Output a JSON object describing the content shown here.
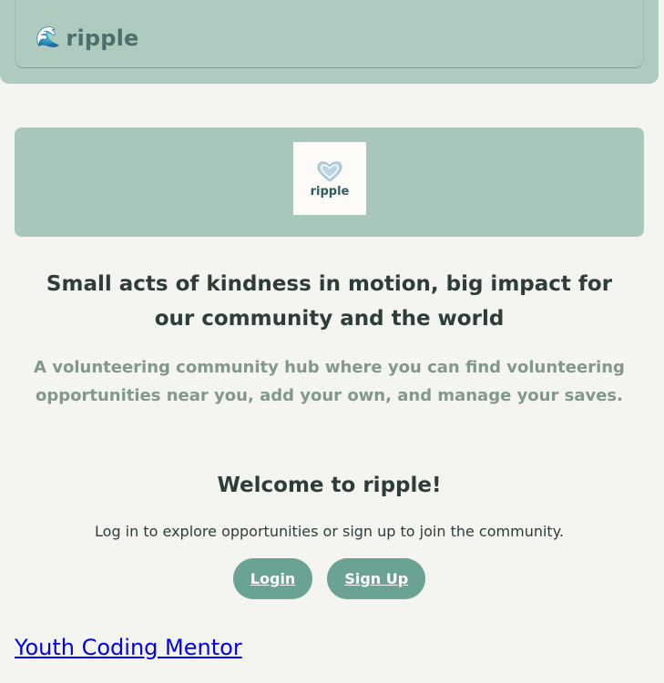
{
  "header": {
    "brand_icon": "wave-icon",
    "brand_icon_glyph": "🌊",
    "brand_name": "ripple"
  },
  "hero": {
    "logo_word": "ripple",
    "logo_icon": "heart-icon"
  },
  "tagline": "Small acts of kindness in motion, big impact for our community and the world",
  "subtagline": "A volunteering community hub where you can find volunteering opportunities near you, add your own, and manage your saves.",
  "welcome": {
    "title": "Welcome to ripple!",
    "subtitle": "Log in to explore opportunities or sign up to join the community.",
    "login_label": "Login",
    "signup_label": "Sign Up"
  },
  "opportunities": [
    {
      "title": "Youth Coding Mentor"
    }
  ],
  "colors": {
    "header_bg": "#afcbbf",
    "hero_bg": "#a8c6b9",
    "button_bg": "#6aa393",
    "page_bg": "#f4f4f0",
    "link": "#0000ee"
  }
}
